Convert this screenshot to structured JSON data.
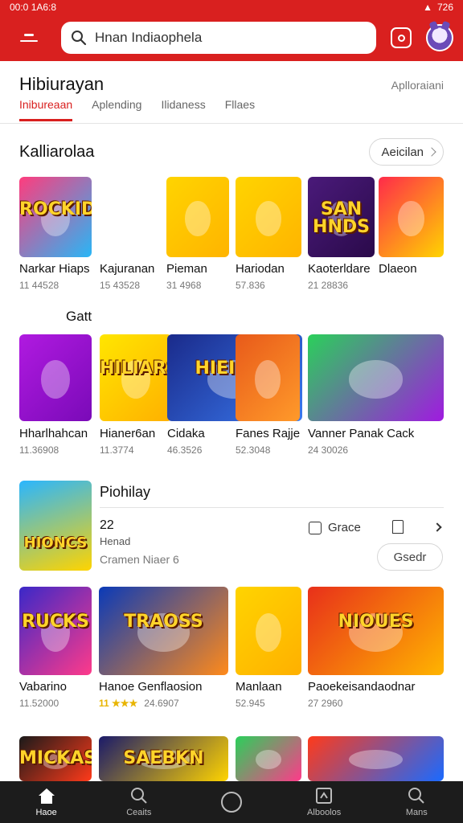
{
  "status_bar": {
    "time": "00:0 1A6:8",
    "battery": "726"
  },
  "search": {
    "value": "Hnan Indiaophela"
  },
  "header": {
    "title": "Hibiurayan",
    "action": "Aplloraiani"
  },
  "tabs": [
    "Inibureaan",
    "Aplending",
    "Ilidaness",
    "Fllaes"
  ],
  "section1": {
    "title": "Kalliarolaa",
    "button": "Aeicilan",
    "games": [
      {
        "name": "Narkar Hiaps",
        "meta": "11 44528",
        "art": "ROCKIDWS",
        "color1": "#ff3c7d",
        "color2": "#28b6f6"
      },
      {
        "name": "Kajuranan",
        "meta": "15 43528",
        "art": "",
        "color1": "#ffffff",
        "color2": "#ffffff"
      },
      {
        "name": "Pieman",
        "meta": "31 4968",
        "art": "",
        "color1": "#ffd400",
        "color2": "#ffb400"
      },
      {
        "name": "Hariodan",
        "meta": "57.836",
        "art": "",
        "color1": "#ffd400",
        "color2": "#ffb400"
      },
      {
        "name": "Kaoterldare",
        "meta": "21 28836",
        "art": "SAN HNDS",
        "color1": "#4a1a7a",
        "color2": "#2a0a4a"
      },
      {
        "name": "Dlaeon",
        "meta": "",
        "art": "",
        "color1": "#ff2a4a",
        "color2": "#ffd400"
      }
    ]
  },
  "section2": {
    "title": "Gatt",
    "games": [
      {
        "name": "Hharlhahcan",
        "meta": "11.36908",
        "art": "",
        "color1": "#b01ae0",
        "color2": "#7a0ab8"
      },
      {
        "name": "Hianer6an",
        "meta": "11.3774",
        "art": "HILIARS",
        "color1": "#ffe600",
        "color2": "#ffb000"
      },
      {
        "name": "Cidaka",
        "meta": "46.3526",
        "art": "HIEIDES",
        "color1": "#1a2a8a",
        "color2": "#3a7af0"
      },
      {
        "name": "Fanes Rajje",
        "meta": "52.3048",
        "art": "",
        "color1": "#e85a1a",
        "color2": "#ff9a2a"
      },
      {
        "name": "Vanner Panak Cack",
        "meta": "24 30026",
        "art": "",
        "color1": "#2ad05a",
        "color2": "#a01ae0"
      }
    ]
  },
  "featured": {
    "title": "Piohilay",
    "line1": "22",
    "line2": "Henad",
    "line3": "Cramen Niaer 6",
    "grace_label": "Grace",
    "button": "Gsedr",
    "art": "HIONCS",
    "color1": "#2ab6ff",
    "color2": "#ffd400"
  },
  "section3": {
    "games": [
      {
        "name": "Vabarino",
        "meta": "11.52000",
        "art": "RUCKS",
        "color1": "#3a28c8",
        "color2": "#ff3a8a"
      },
      {
        "name": "Hanoe Genflaosion",
        "meta": "24.6907",
        "stars": "11 ★★★",
        "art": "TRAOSS",
        "color1": "#0a3ab8",
        "color2": "#ff8a1a"
      },
      {
        "name": "Manlaan",
        "meta": "52.945",
        "art": "",
        "color1": "#ffd400",
        "color2": "#ffb000"
      },
      {
        "name": "Paoekeisandaodnar",
        "meta": "27 2960",
        "art": "NIOUES",
        "color1": "#e8301a",
        "color2": "#ffb400"
      }
    ]
  },
  "section4": {
    "games": [
      {
        "art": "MICKAS",
        "color1": "#1a1a1a",
        "color2": "#ff3a1a"
      },
      {
        "art": "SAEBKN",
        "color1": "#1a1a6a",
        "color2": "#ffd400"
      },
      {
        "art": "",
        "color1": "#2ad05a",
        "color2": "#ff3a8a"
      },
      {
        "art": "",
        "color1": "#ff3a1a",
        "color2": "#1a6aff"
      }
    ]
  },
  "nav": [
    "Haoe",
    "Ceaits",
    "",
    "Alboolos",
    "Mans"
  ]
}
